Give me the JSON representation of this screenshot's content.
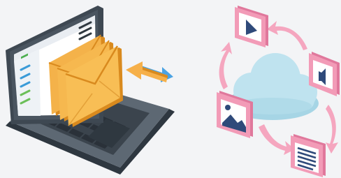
{
  "illustration": {
    "left": {
      "subject": "laptop-email",
      "icons": [
        "laptop-icon",
        "envelope-icon",
        "transfer-arrows-icon"
      ]
    },
    "right": {
      "subject": "cloud-media-cycle",
      "icons": [
        "cloud-icon",
        "play-icon",
        "audio-icon",
        "image-icon",
        "document-icon",
        "cycle-arrow-icon"
      ]
    }
  },
  "colors": {
    "background": "#f3f4f6",
    "laptop_body": "#4a5560",
    "laptop_deck": "#5d6873",
    "keys": "#2f3840",
    "screen": "#ffffff",
    "screen_accent": "#3a9bd8",
    "envelope": "#f0a83a",
    "envelope_dark": "#d98a1e",
    "arrow_blue": "#4ba3e3",
    "arrow_orange": "#f6b04a",
    "cloud": "#bfe3ef",
    "cloud_shade": "#a6d5e5",
    "card_frame": "#f29bb7",
    "card_frame_dark": "#e0789c",
    "card_inner": "#ffffff",
    "media_icon": "#2f4a7a",
    "cycle_arrow": "#f5a6bf"
  }
}
